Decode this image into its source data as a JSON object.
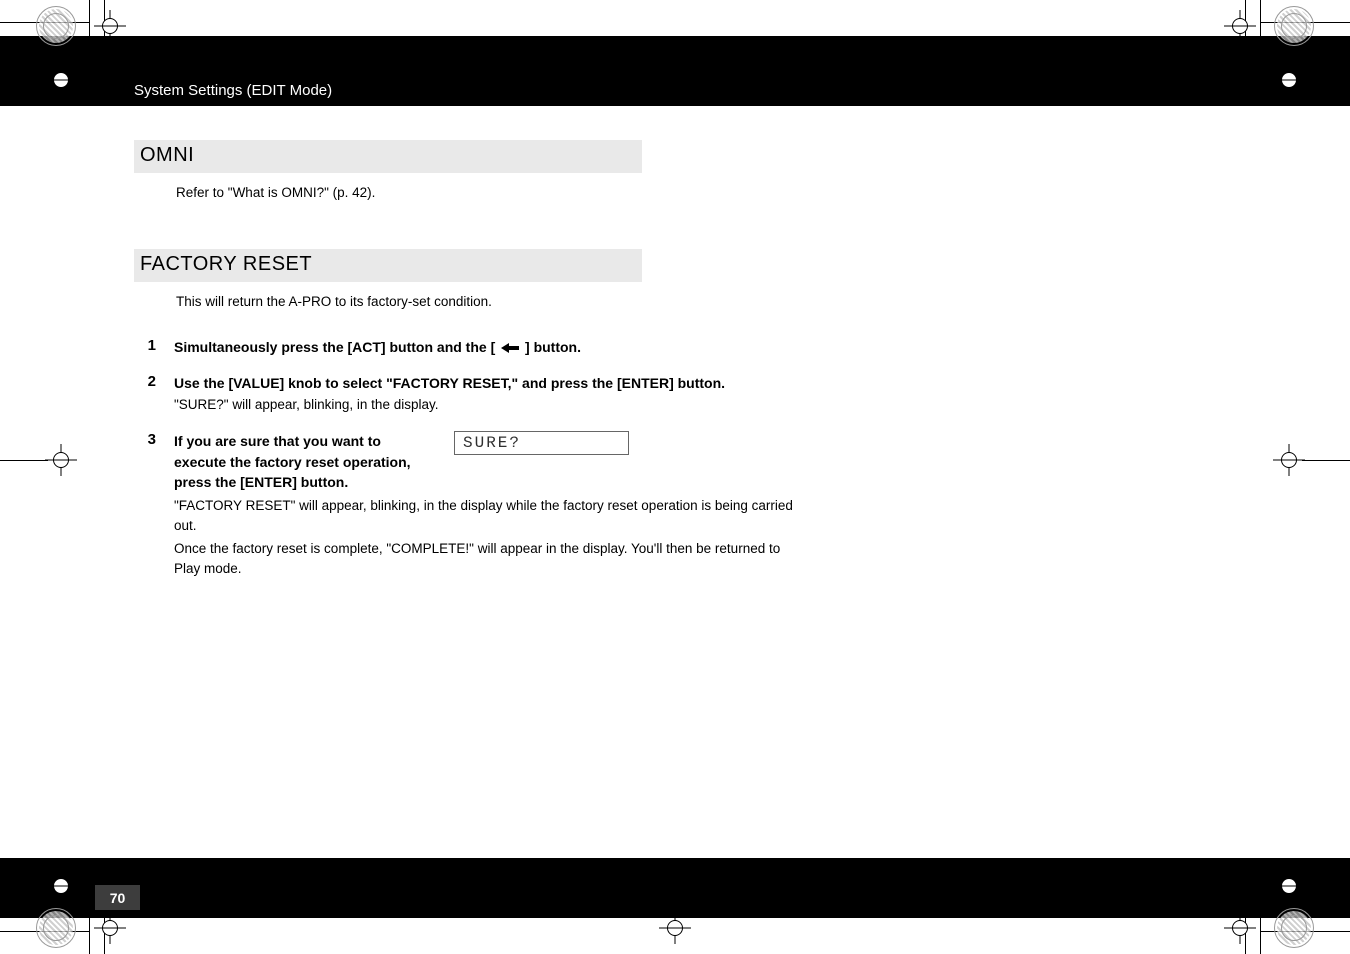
{
  "header_title": "System Settings (EDIT Mode)",
  "page_number": "70",
  "omni": {
    "heading": "OMNI",
    "ref_text": "Refer to  \"What is OMNI?\" (p. 42)."
  },
  "factory_reset": {
    "heading": "FACTORY RESET",
    "intro": "This will return the A-PRO to its factory-set condition.",
    "steps": {
      "s1": {
        "num": "1",
        "main_a": "Simultaneously press the [ACT] button and the [ ",
        "main_b": " ] button."
      },
      "s2": {
        "num": "2",
        "main": "Use the [VALUE] knob to select \"FACTORY RESET,\" and press the [ENTER] button.",
        "note": "\"SURE?\" will appear, blinking, in the display."
      },
      "s3": {
        "num": "3",
        "main": "If you are sure that you want to execute the factory reset operation, press the [ENTER] button.",
        "lcd": "SURE?",
        "note_a": "\"FACTORY RESET\" will appear, blinking, in the display while the factory reset operation is being carried out.",
        "note_b": "Once the factory reset is complete, \"COMPLETE!\" will appear in the display. You'll then be returned to Play mode."
      }
    }
  }
}
